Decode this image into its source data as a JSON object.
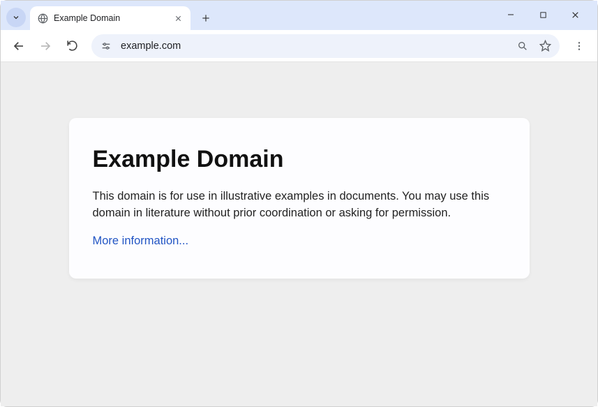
{
  "tab": {
    "title": "Example Domain"
  },
  "omnibox": {
    "url": "example.com"
  },
  "page": {
    "heading": "Example Domain",
    "body": "This domain is for use in illustrative examples in documents. You may use this domain in literature without prior coordination or asking for permission.",
    "link_text": "More information..."
  }
}
